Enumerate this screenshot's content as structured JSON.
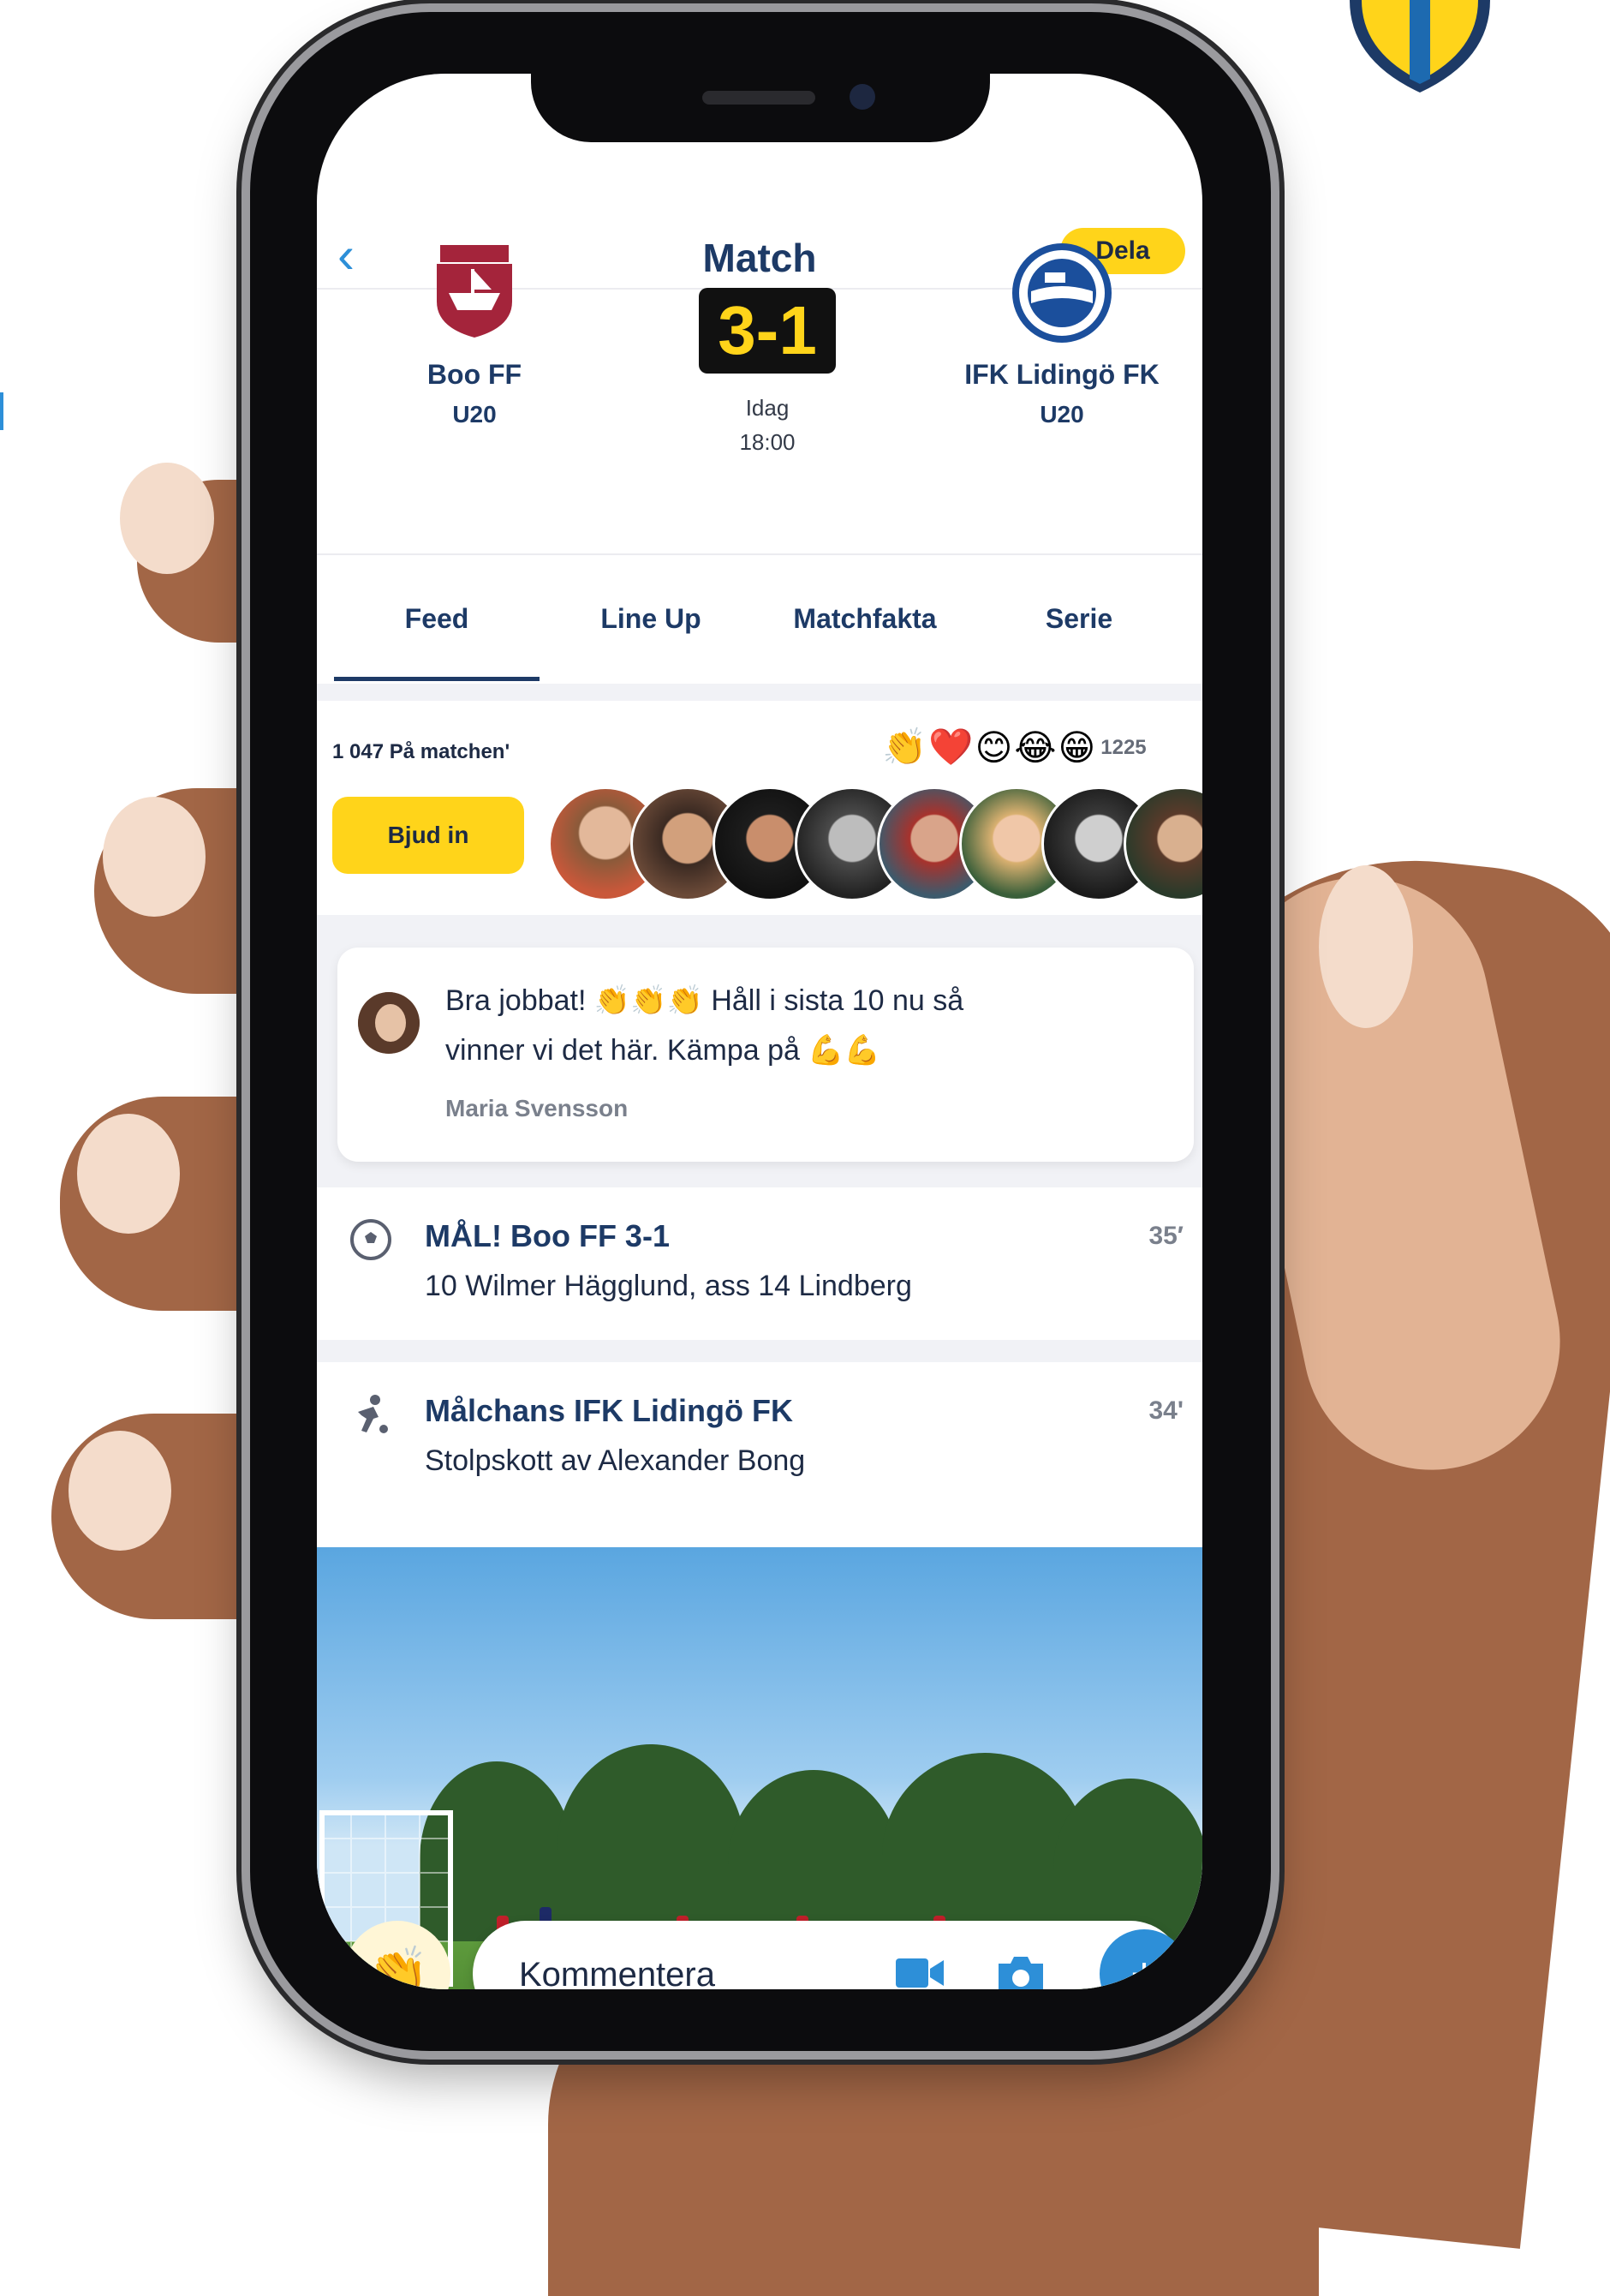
{
  "navbar": {
    "title": "Match",
    "share_label": "Dela"
  },
  "match": {
    "home_team": {
      "name": "Boo FF",
      "group": "U20"
    },
    "away_team": {
      "name": "IFK Lidingö FK",
      "group": "U20"
    },
    "score": "3-1",
    "day": "Idag",
    "time": "18:00"
  },
  "tabs": [
    "Feed",
    "Line Up",
    "Matchfakta",
    "Serie"
  ],
  "presence": {
    "count_text": "1 047 På matchen'",
    "reaction_count": "1225",
    "invite_label": "Bjud in"
  },
  "feed": {
    "comment": {
      "line1": "Bra jobbat! 👏👏👏 Håll i sista 10 nu så",
      "line2": "vinner vi det här. Kämpa på 💪💪",
      "author": "Maria Svensson"
    },
    "events": [
      {
        "title": "MÅL! Boo FF 3-1",
        "sub": "10 Wilmer Hägglund, ass 14 Lindberg",
        "minute": "35′",
        "icon": "soccer-ball-icon"
      },
      {
        "title": "Målchans IFK Lidingö FK",
        "sub": "Stolpskott av Alexander Bong",
        "minute": "34'",
        "icon": "kicking-player-icon"
      }
    ]
  },
  "comment_bar": {
    "placeholder": "Kommentera"
  },
  "colors": {
    "brand_blue": "#1d3a66",
    "accent_blue": "#2d8fd8",
    "accent_yellow": "#ffd41a"
  }
}
